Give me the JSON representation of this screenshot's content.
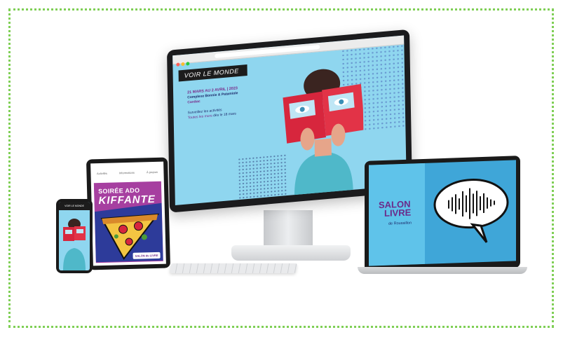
{
  "monitor": {
    "banner": "VOIR LE MONDE",
    "date": "21 MARS AU 2 AVRIL | 2023",
    "place": "Complexe Bonnie & Patamiole",
    "city": "Cardiac",
    "info_line1": "Surveillez les activités",
    "info_hl": "Toutes les murs",
    "info_line2": " dès le 18 mars"
  },
  "tablet": {
    "menu": [
      "Activités",
      "Informations",
      "À propos"
    ],
    "title_line1": "SOIRÉE ADO",
    "title_line2": "KIFFANTE",
    "badge": "SALON du LIVRE"
  },
  "phone": {
    "header": "VOIR LE MONDE"
  },
  "laptop": {
    "logo_line1": "SALON",
    "logo_line2": "LIVRE",
    "logo_sub": "de Roussillon"
  },
  "colors": {
    "frame": "#7fcf55",
    "sky": "#8fd6ef",
    "purple": "#6b2a8a",
    "red_book": "#d7263d"
  }
}
